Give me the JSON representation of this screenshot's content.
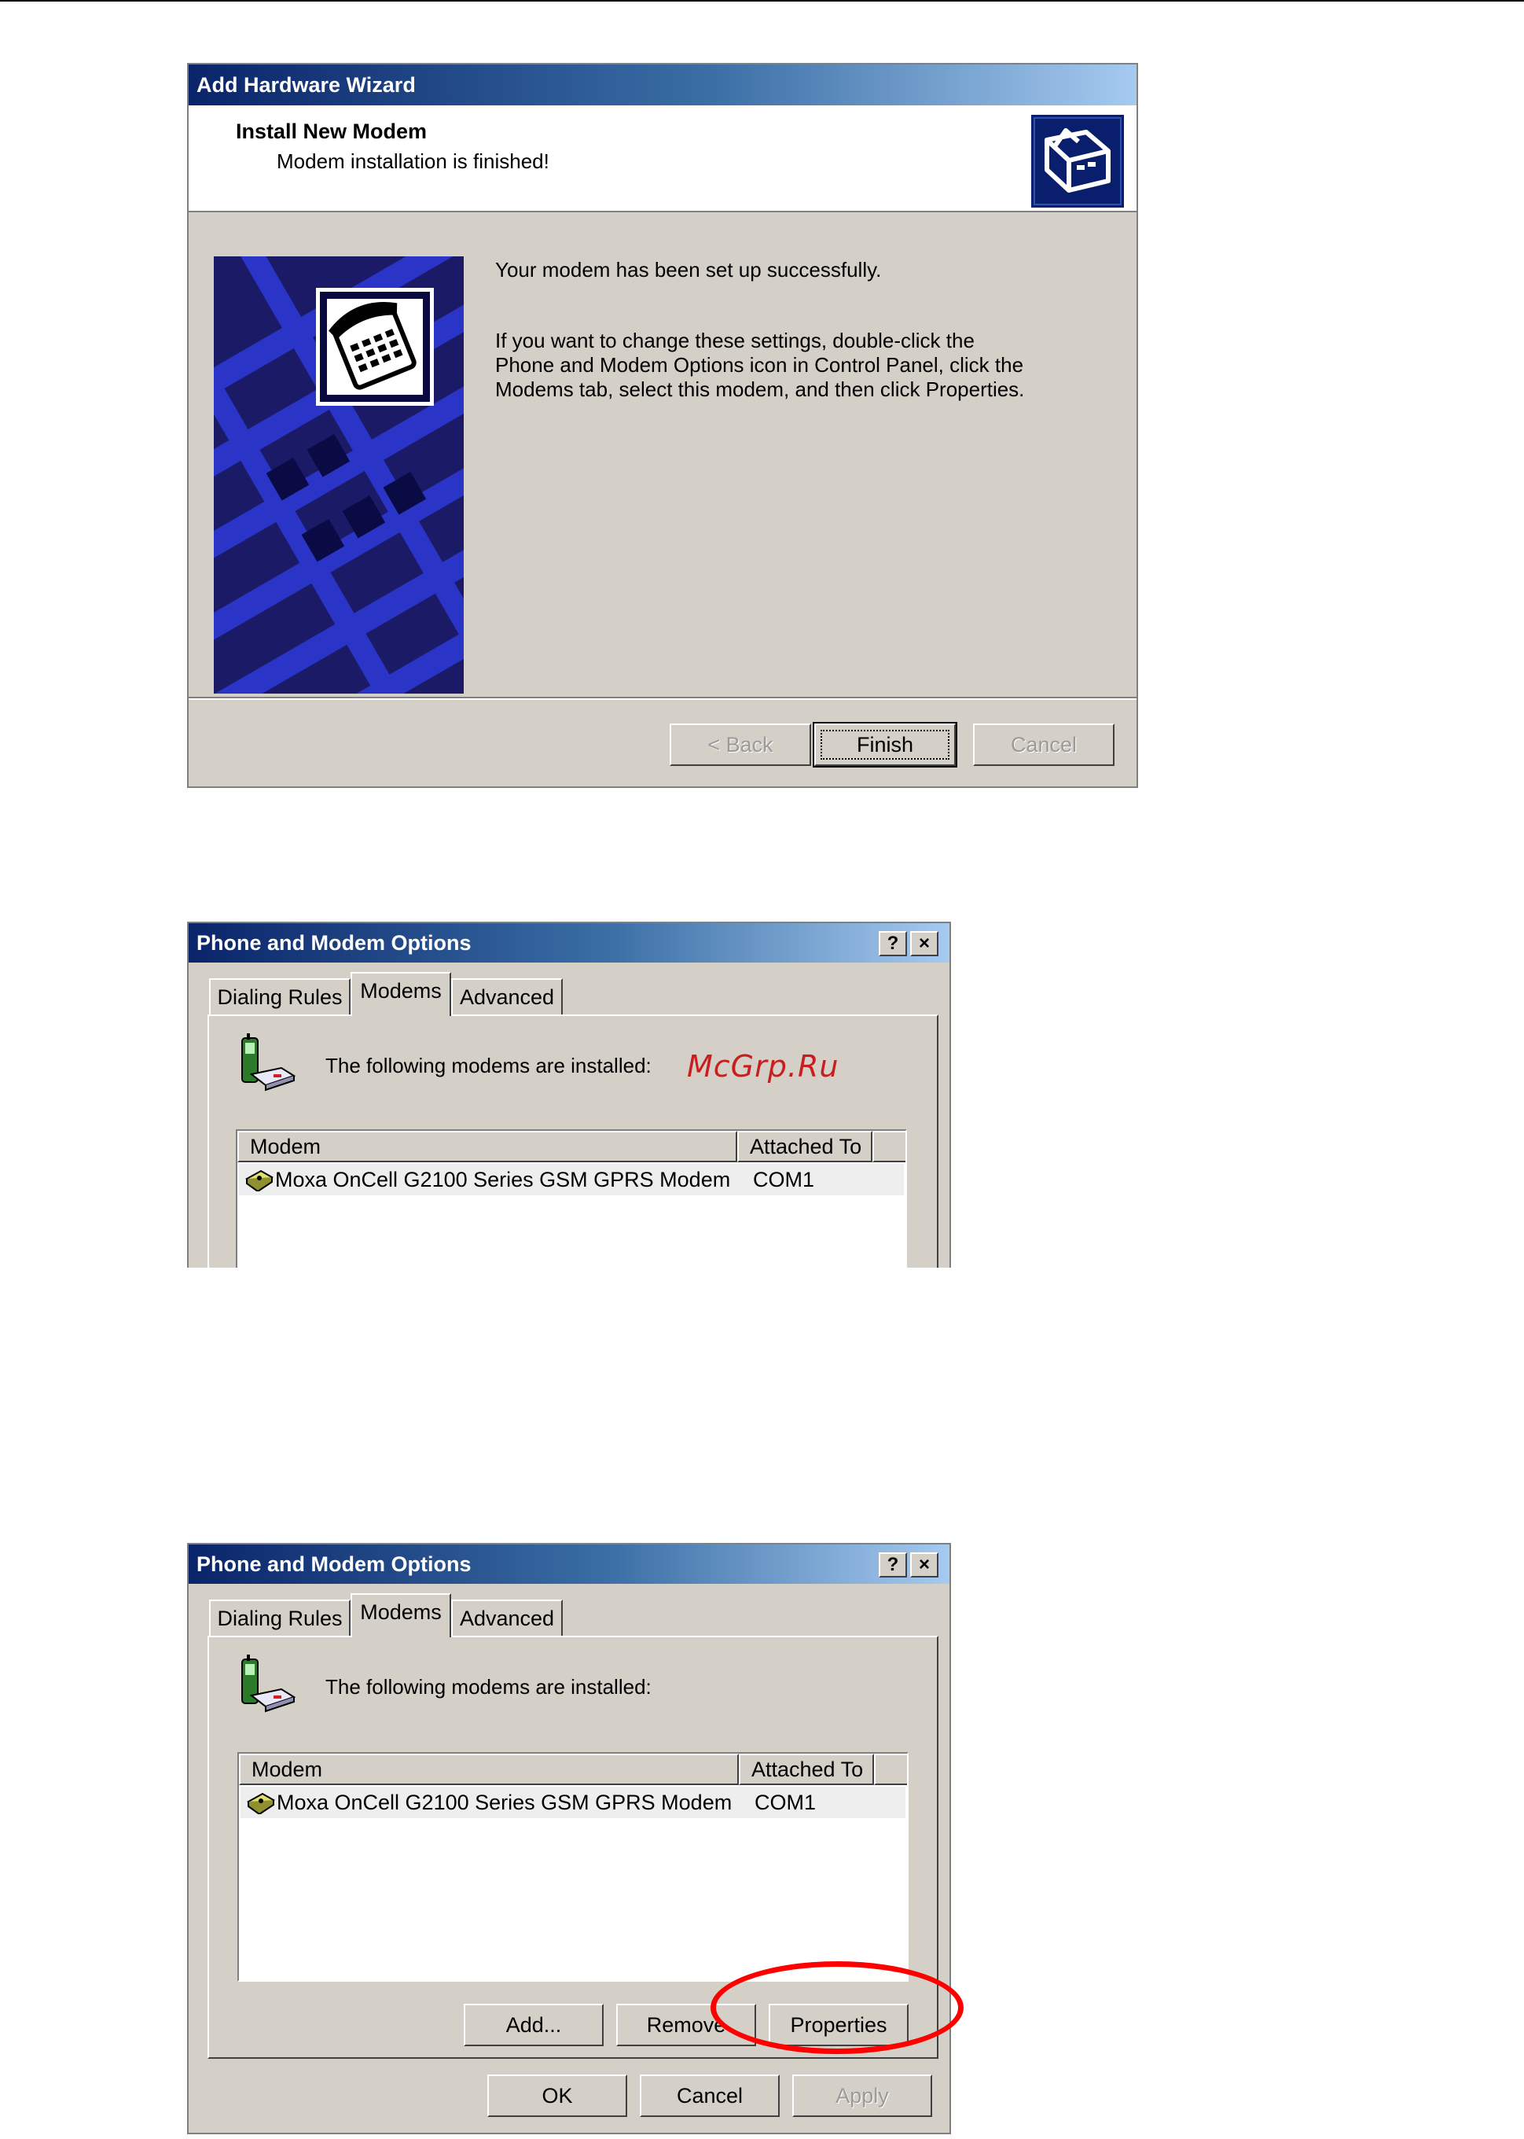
{
  "wizard": {
    "title": "Add Hardware Wizard",
    "heading": "Install New Modem",
    "subheading": "Modem installation is finished!",
    "message_1": "Your modem has been set up successfully.",
    "message_2_lines": [
      "If you want to change these settings, double-click the",
      "Phone and Modem Options icon in Control Panel, click the",
      "Modems tab, select this modem, and then click Properties."
    ],
    "buttons": {
      "back": "< Back",
      "finish": "Finish",
      "cancel": "Cancel"
    }
  },
  "dialog1": {
    "title": "Phone and Modem Options",
    "help_button": "?",
    "close_button": "×",
    "tabs": [
      "Dialing Rules",
      "Modems",
      "Advanced"
    ],
    "installed_label": "The following modems are  installed:",
    "columns": [
      "Modem",
      "Attached To"
    ],
    "rows": [
      {
        "modem": "Moxa OnCell G2100 Series GSM GPRS Modem",
        "port": "COM1"
      }
    ],
    "watermark": "McGrp.Ru"
  },
  "dialog2": {
    "title": "Phone and Modem Options",
    "help_button": "?",
    "close_button": "×",
    "tabs": [
      "Dialing Rules",
      "Modems",
      "Advanced"
    ],
    "installed_label": "The following modems are  installed:",
    "columns": [
      "Modem",
      "Attached To"
    ],
    "rows": [
      {
        "modem": "Moxa OnCell G2100 Series GSM GPRS Modem",
        "port": "COM1"
      }
    ],
    "buttons": {
      "add": "Add...",
      "remove": "Remove",
      "properties": "Properties",
      "ok": "OK",
      "cancel": "Cancel",
      "apply": "Apply"
    }
  }
}
